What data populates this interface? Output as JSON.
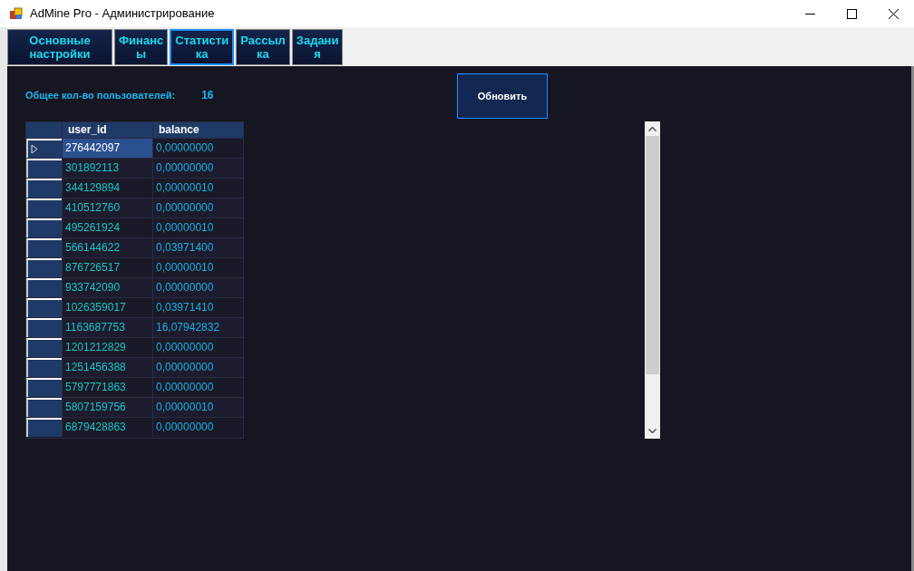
{
  "window": {
    "title": "AdMine Pro - Администрирование"
  },
  "tabs": [
    {
      "label": "Основные\nнастройки",
      "selected": false
    },
    {
      "label": "Финанс\nы",
      "selected": false
    },
    {
      "label": "Статисти\nка",
      "selected": true
    },
    {
      "label": "Рассыл\nка",
      "selected": false
    },
    {
      "label": "Задани\nя",
      "selected": false
    }
  ],
  "stats": {
    "label": "Общее кол-во пользователей:",
    "value": "16"
  },
  "refresh_button": {
    "label": "Обновить"
  },
  "table": {
    "columns": [
      "user_id",
      "balance"
    ],
    "rows": [
      {
        "selected": true,
        "cells": [
          "276442097",
          "0,00000000"
        ]
      },
      {
        "selected": false,
        "cells": [
          "301892113",
          "0,00000000"
        ]
      },
      {
        "selected": false,
        "cells": [
          "344129894",
          "0,00000010"
        ]
      },
      {
        "selected": false,
        "cells": [
          "410512760",
          "0,00000000"
        ]
      },
      {
        "selected": false,
        "cells": [
          "495261924",
          "0,00000010"
        ]
      },
      {
        "selected": false,
        "cells": [
          "566144622",
          "0,03971400"
        ]
      },
      {
        "selected": false,
        "cells": [
          "876726517",
          "0,00000010"
        ]
      },
      {
        "selected": false,
        "cells": [
          "933742090",
          "0,00000000"
        ]
      },
      {
        "selected": false,
        "cells": [
          "1026359017",
          "0,03971410"
        ]
      },
      {
        "selected": false,
        "cells": [
          "1163687753",
          "16,07942832"
        ]
      },
      {
        "selected": false,
        "cells": [
          "1201212829",
          "0,00000000"
        ]
      },
      {
        "selected": false,
        "cells": [
          "1251456388",
          "0,00000000"
        ]
      },
      {
        "selected": false,
        "cells": [
          "5797771863",
          "0,00000000"
        ]
      },
      {
        "selected": false,
        "cells": [
          "5807159756",
          "0,00000010"
        ]
      },
      {
        "selected": false,
        "cells": [
          "6879428863",
          "0,00000000"
        ]
      }
    ]
  }
}
